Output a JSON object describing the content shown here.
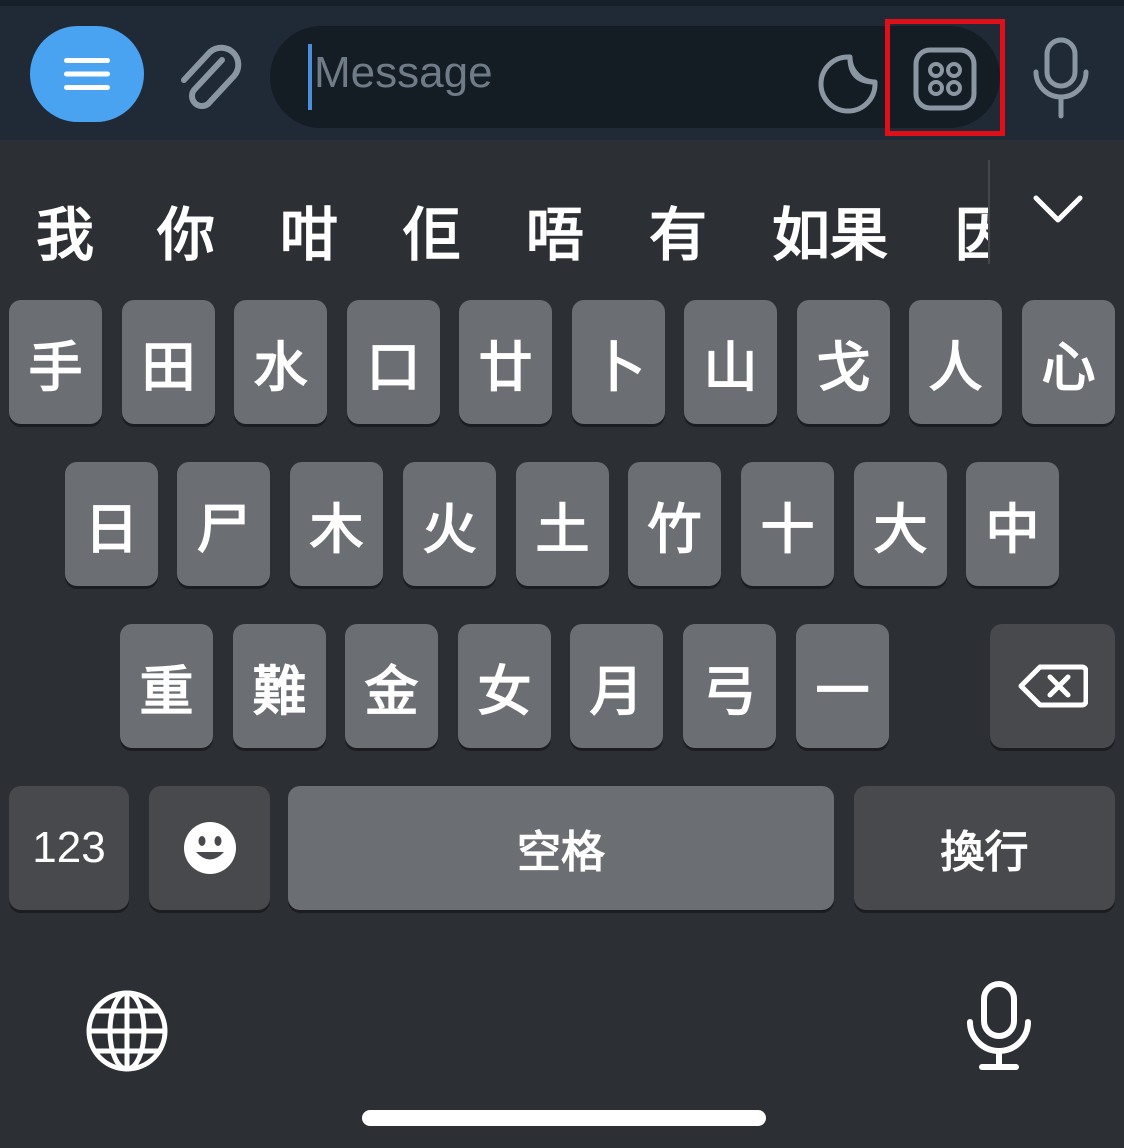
{
  "composer": {
    "placeholder": "Message",
    "accent_color": "#4aa3f0",
    "highlight_color": "#e0101a"
  },
  "suggestions": [
    "我",
    "你",
    "咁",
    "佢",
    "唔",
    "有",
    "如果",
    "因"
  ],
  "keyboard": {
    "row1": [
      "手",
      "田",
      "水",
      "口",
      "廿",
      "卜",
      "山",
      "戈",
      "人",
      "心"
    ],
    "row2": [
      "日",
      "尸",
      "木",
      "火",
      "土",
      "竹",
      "十",
      "大",
      "中"
    ],
    "row3": [
      "重",
      "難",
      "金",
      "女",
      "月",
      "弓",
      "一"
    ],
    "numbers_label": "123",
    "space_label": "空格",
    "return_label": "換行"
  },
  "icons": {
    "menu": "menu-icon",
    "attach": "paperclip-icon",
    "sticker": "sticker-icon",
    "bot_commands": "bot-commands-icon",
    "microphone": "microphone-icon",
    "chevron": "chevron-down-icon",
    "backspace": "backspace-icon",
    "emoji": "emoji-icon",
    "globe": "globe-icon"
  }
}
